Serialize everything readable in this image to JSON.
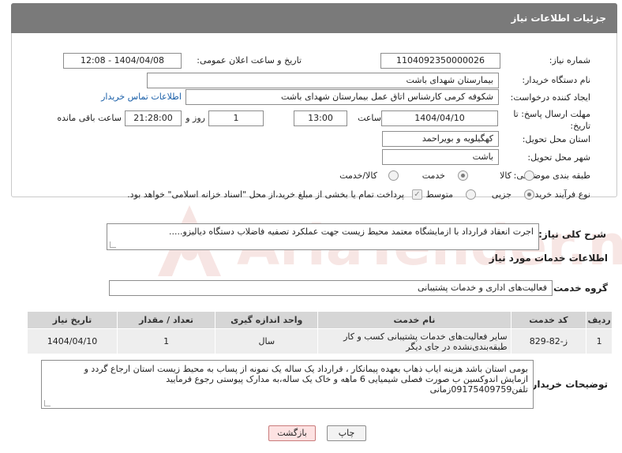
{
  "panel_title": "جزئیات اطلاعات نیاز",
  "need_number": {
    "label": "شماره نیاز:",
    "value": "1104092350000026"
  },
  "announce": {
    "label": "تاریخ و ساعت اعلان عمومی:",
    "value": "1404/04/08 - 12:08"
  },
  "buyer_org": {
    "label": "نام دستگاه خریدار:",
    "value": "بیمارستان شهدای باشت"
  },
  "requester": {
    "label": "ایجاد کننده درخواست:",
    "value": "شکوفه کرمی کارشناس اتاق عمل بیمارستان شهدای باشت",
    "contact_link": "اطلاعات تماس خریدار"
  },
  "deadline": {
    "label": "مهلت ارسال پاسخ: تا تاریخ:",
    "date": "1404/04/10",
    "time_label": "ساعت",
    "time": "13:00",
    "days": "1",
    "days_label": "روز و",
    "remaining": "21:28:00",
    "remaining_label": "ساعت باقی مانده"
  },
  "province": {
    "label": "استان محل تحویل:",
    "value": "کهگیلویه و بویراحمد"
  },
  "city": {
    "label": "شهر محل تحویل:",
    "value": "باشت"
  },
  "category": {
    "label": "طبقه بندی موضوعی:",
    "options": [
      "کالا",
      "خدمت",
      "کالا/خدمت"
    ],
    "selected": "خدمت"
  },
  "process": {
    "label": "نوع فرآیند خرید :",
    "options": [
      "جزیی",
      "متوسط"
    ],
    "selected": "جزیی",
    "payment_note": "پرداخت تمام یا بخشی از مبلغ خرید،از محل \"اسناد خزانه اسلامی\" خواهد بود."
  },
  "summary": {
    "label": "شرح کلی نیاز:",
    "value": "اجرت انعقاد قرارداد با ازمایشگاه معتمد محیط زیست جهت عملکرد تصفیه فاضلاب  دستگاه دیالیزو....."
  },
  "services_title": "اطلاعات خدمات مورد نیاز",
  "service_group": {
    "label": "گروه خدمت:",
    "value": "فعالیت‌های اداری و خدمات پشتیبانی"
  },
  "table": {
    "headers": [
      "ردیف",
      "کد خدمت",
      "نام خدمت",
      "واحد اندازه گیری",
      "تعداد / مقدار",
      "تاریخ نیاز"
    ],
    "rows": [
      [
        "1",
        "ز-82-829",
        "سایر فعالیت‌های خدمات پشتیبانی کسب و کار طبقه‌بندی‌نشده در جای دیگر",
        "سال",
        "1",
        "1404/04/10"
      ]
    ]
  },
  "buyer_notes": {
    "label": "توضیحات خریدار:",
    "lines": [
      "بومی استان باشد هزینه ایاب ذهاب بعهده پیمانکار ، قرارداد یک ساله  یک نمونه از پساب به محیط زیست استان ارجاع گردد و",
      "ازمایش اندوکسین ب صورت فصلی شیمیایی 6 ماهه و خاک یک ساله،به مدارک پیوستی رجوع فرمایید",
      "تلفن09175409759زمانی"
    ]
  },
  "buttons": {
    "print": "چاپ",
    "back": "بازگشت"
  },
  "watermark": "AriaTender.net"
}
